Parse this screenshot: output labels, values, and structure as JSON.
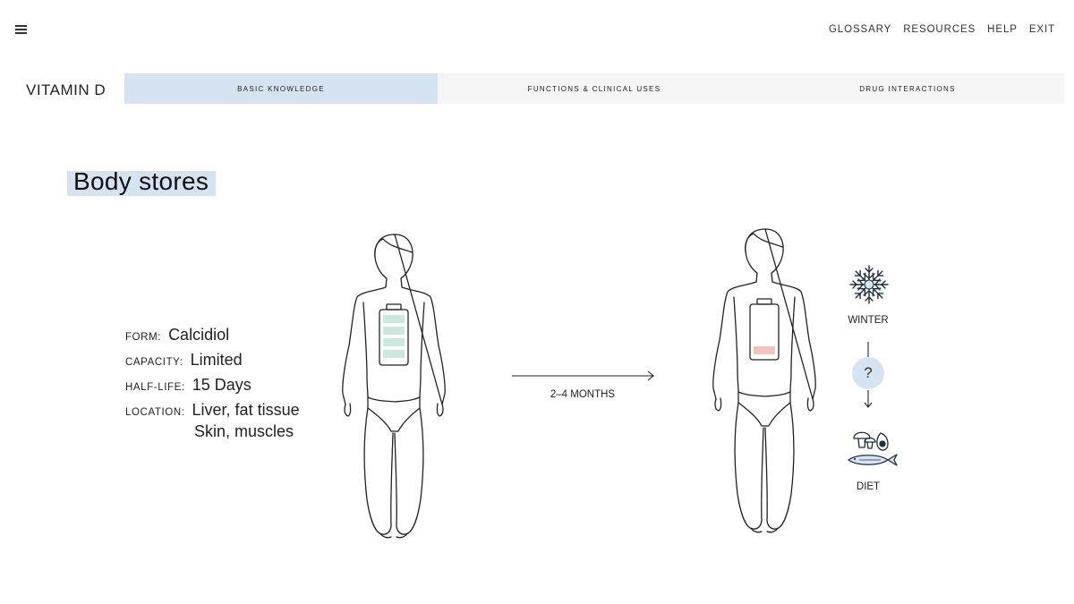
{
  "header": {
    "menu_icon": "hamburger-menu-icon",
    "nav": [
      "GLOSSARY",
      "RESOURCES",
      "HELP",
      "EXIT"
    ]
  },
  "app": {
    "title": "VITAMIN D"
  },
  "tabs": [
    {
      "label": "BASIC KNOWLEDGE",
      "active": true
    },
    {
      "label": "FUNCTIONS & CLINICAL USES",
      "active": false
    },
    {
      "label": "DRUG INTERACTIONS",
      "active": false
    }
  ],
  "section": {
    "title": "Body stores"
  },
  "facts": [
    {
      "label": "FORM:",
      "value": "Calcidiol"
    },
    {
      "label": "CAPACITY:",
      "value": "Limited"
    },
    {
      "label": "HALF-LIFE:",
      "value": "15 Days"
    },
    {
      "label": "LOCATION:",
      "value": "Liver, fat tissue"
    }
  ],
  "facts_extra": "Skin, muscles",
  "transition": {
    "label": "2–4 MONTHS"
  },
  "factors": {
    "winter_label": "WINTER",
    "question": "?",
    "diet_label": "DIET"
  },
  "colors": {
    "accent_light_blue": "#d6e4f2",
    "tab_background": "#f5f5f5",
    "battery_full_green": "#cce7dc",
    "battery_low_red": "#f4c2bb",
    "line": "#222222"
  },
  "stores": {
    "before_level": 1.0,
    "after_level": 0.2
  },
  "icons": [
    "hamburger-menu-icon",
    "body-figure-icon",
    "battery-icon",
    "arrow-right-icon",
    "snowflake-icon",
    "question-icon",
    "arrow-down-icon",
    "mushroom-icon",
    "avocado-icon",
    "fish-icon"
  ]
}
